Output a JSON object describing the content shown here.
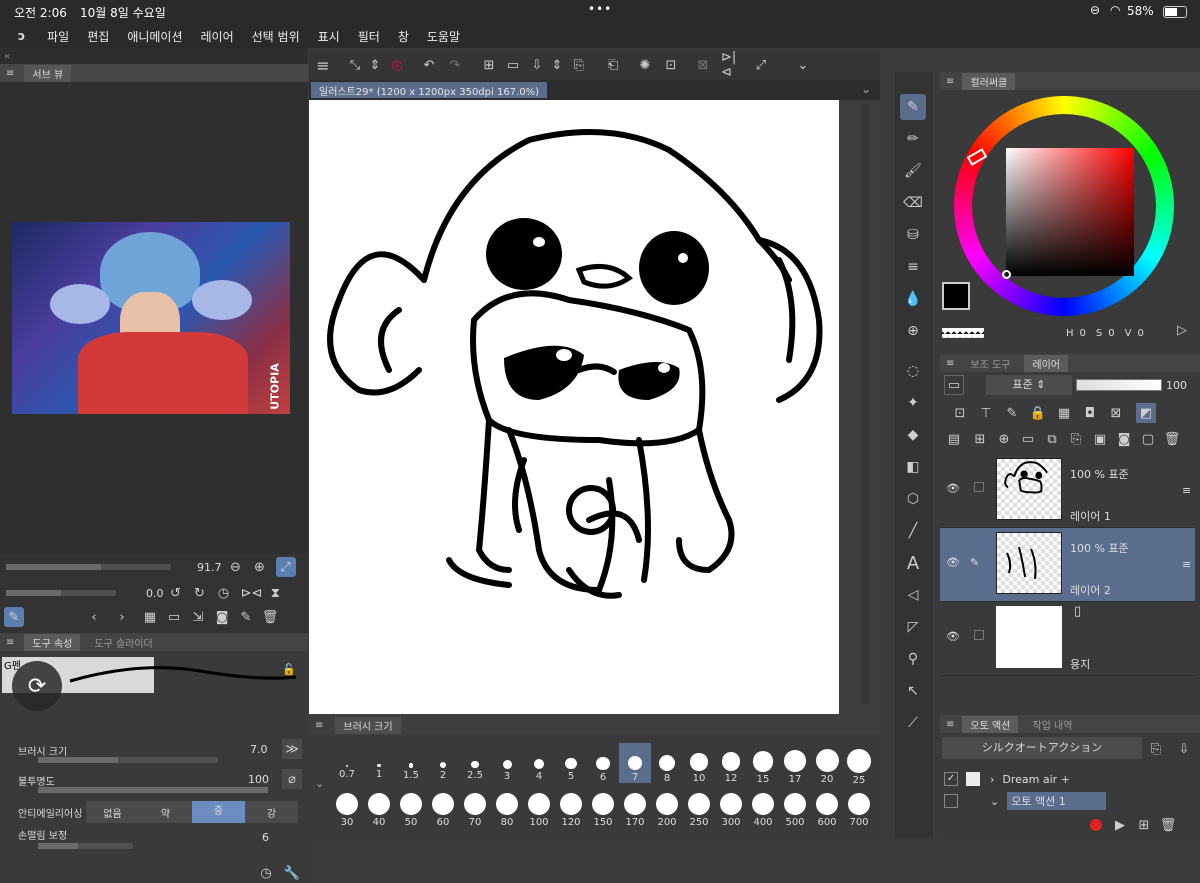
{
  "status": {
    "time": "오전 2:06",
    "date": "10월 8일 수요일",
    "dots": "•••",
    "battery": "58%"
  },
  "menu": [
    "파일",
    "편집",
    "애니메이션",
    "레이어",
    "선택 범위",
    "표시",
    "필터",
    "창",
    "도움말"
  ],
  "subview": {
    "title": "서브 뷰",
    "zoom": "91.7",
    "rotation": "0.0",
    "photo_watermark": "UTOPIA"
  },
  "tool_props": {
    "tab1": "도구 속성",
    "tab2": "도구 슬라이더",
    "brush_label": "G펜",
    "rows": [
      {
        "label": "브러시 크기",
        "value": "7.0"
      },
      {
        "label": "불투명도",
        "value": "100"
      },
      {
        "label": "안티에일리어싱",
        "value": ""
      },
      {
        "label": "손떨림 보정",
        "value": "6"
      }
    ],
    "aa_options": [
      "없음",
      "약",
      "중",
      "강"
    ],
    "aa_selected": "중"
  },
  "canvas": {
    "tab_title": "일러스트29* (1200 x 1200px 350dpi 167.0%)"
  },
  "brush_size": {
    "title": "브러시 크기",
    "row1": [
      "0.7",
      "1",
      "1.5",
      "2",
      "2.5",
      "3",
      "4",
      "5",
      "6",
      "7",
      "8",
      "10",
      "12",
      "15",
      "17",
      "20",
      "25"
    ],
    "row2": [
      "30",
      "40",
      "50",
      "60",
      "70",
      "80",
      "100",
      "120",
      "150",
      "170",
      "200",
      "250",
      "300",
      "400",
      "500",
      "600",
      "700"
    ],
    "selected": "7"
  },
  "color": {
    "tab": "컬러써클",
    "h": "0",
    "s": "0",
    "v": "0",
    "h_label": "H",
    "s_label": "S",
    "v_label": "V",
    "main_color": "#000000",
    "sub_color": "#ffffff"
  },
  "layers_panel": {
    "tab1": "보조 도구",
    "tab2": "레이어",
    "blend": "표준",
    "opacity": "100",
    "layers": [
      {
        "name": "레이어 1",
        "opacity": "100 % 표준"
      },
      {
        "name": "레이어 2",
        "opacity": "100 % 표준"
      },
      {
        "name": "용지",
        "opacity": ""
      }
    ]
  },
  "auto_action": {
    "tab1": "오토 액션",
    "tab2": "작업 내역",
    "set": "シルクオートアクション",
    "items": [
      "Dream air +",
      "오토 액션 1"
    ]
  }
}
